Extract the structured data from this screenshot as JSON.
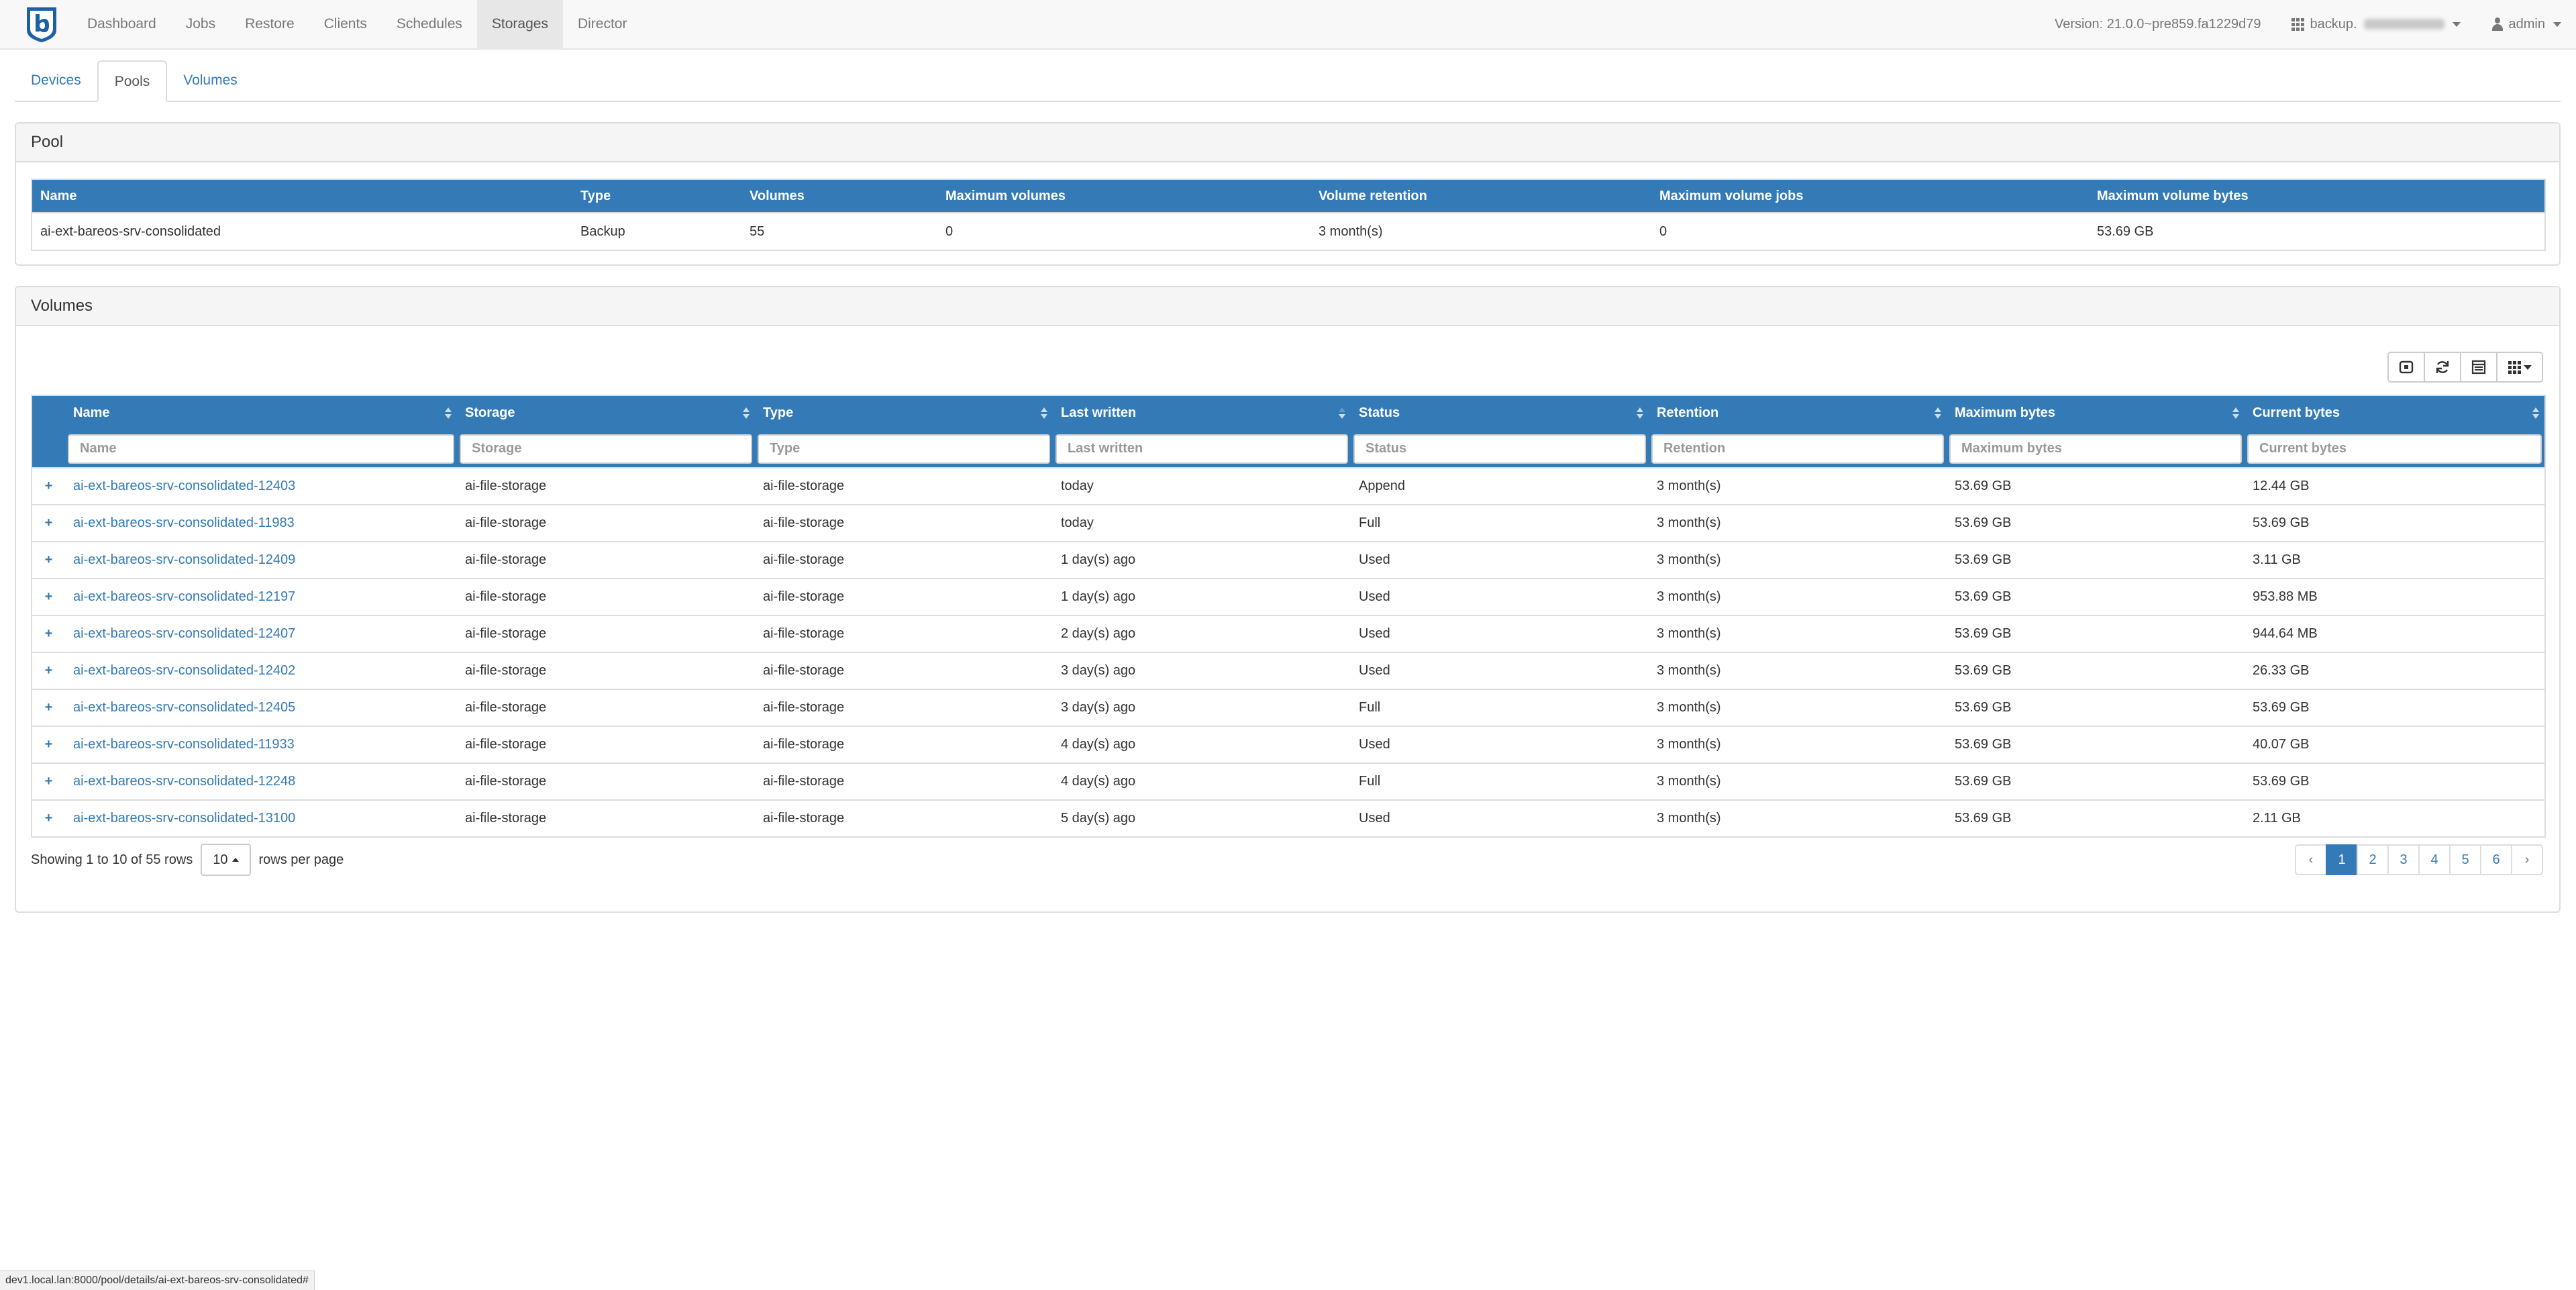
{
  "navbar": {
    "items": [
      {
        "label": "Dashboard"
      },
      {
        "label": "Jobs"
      },
      {
        "label": "Restore"
      },
      {
        "label": "Clients"
      },
      {
        "label": "Schedules"
      },
      {
        "label": "Storages"
      },
      {
        "label": "Director"
      }
    ],
    "active_index": 5,
    "version": "Version: 21.0.0~pre859.fa1229d79",
    "director_label": "backup.",
    "user_label": "admin"
  },
  "subtabs": [
    {
      "label": "Devices"
    },
    {
      "label": "Pools"
    },
    {
      "label": "Volumes"
    }
  ],
  "pool_panel": {
    "title": "Pool",
    "columns": [
      "Name",
      "Type",
      "Volumes",
      "Maximum volumes",
      "Volume retention",
      "Maximum volume jobs",
      "Maximum volume bytes"
    ],
    "row": [
      "ai-ext-bareos-srv-consolidated",
      "Backup",
      "55",
      "0",
      "3 month(s)",
      "0",
      "53.69 GB"
    ]
  },
  "volumes_panel": {
    "title": "Volumes",
    "columns": [
      "Name",
      "Storage",
      "Type",
      "Last written",
      "Status",
      "Retention",
      "Maximum bytes",
      "Current bytes"
    ],
    "filter_placeholders": [
      "Name",
      "Storage",
      "Type",
      "Last written",
      "Status",
      "Retention",
      "Maximum bytes",
      "Current bytes"
    ],
    "rows": [
      [
        "ai-ext-bareos-srv-consolidated-12403",
        "ai-file-storage",
        "ai-file-storage",
        "today",
        "Append",
        "3 month(s)",
        "53.69 GB",
        "12.44 GB"
      ],
      [
        "ai-ext-bareos-srv-consolidated-11983",
        "ai-file-storage",
        "ai-file-storage",
        "today",
        "Full",
        "3 month(s)",
        "53.69 GB",
        "53.69 GB"
      ],
      [
        "ai-ext-bareos-srv-consolidated-12409",
        "ai-file-storage",
        "ai-file-storage",
        "1 day(s) ago",
        "Used",
        "3 month(s)",
        "53.69 GB",
        "3.11 GB"
      ],
      [
        "ai-ext-bareos-srv-consolidated-12197",
        "ai-file-storage",
        "ai-file-storage",
        "1 day(s) ago",
        "Used",
        "3 month(s)",
        "53.69 GB",
        "953.88 MB"
      ],
      [
        "ai-ext-bareos-srv-consolidated-12407",
        "ai-file-storage",
        "ai-file-storage",
        "2 day(s) ago",
        "Used",
        "3 month(s)",
        "53.69 GB",
        "944.64 MB"
      ],
      [
        "ai-ext-bareos-srv-consolidated-12402",
        "ai-file-storage",
        "ai-file-storage",
        "3 day(s) ago",
        "Used",
        "3 month(s)",
        "53.69 GB",
        "26.33 GB"
      ],
      [
        "ai-ext-bareos-srv-consolidated-12405",
        "ai-file-storage",
        "ai-file-storage",
        "3 day(s) ago",
        "Full",
        "3 month(s)",
        "53.69 GB",
        "53.69 GB"
      ],
      [
        "ai-ext-bareos-srv-consolidated-11933",
        "ai-file-storage",
        "ai-file-storage",
        "4 day(s) ago",
        "Used",
        "3 month(s)",
        "53.69 GB",
        "40.07 GB"
      ],
      [
        "ai-ext-bareos-srv-consolidated-12248",
        "ai-file-storage",
        "ai-file-storage",
        "4 day(s) ago",
        "Full",
        "3 month(s)",
        "53.69 GB",
        "53.69 GB"
      ],
      [
        "ai-ext-bareos-srv-consolidated-13100",
        "ai-file-storage",
        "ai-file-storage",
        "5 day(s) ago",
        "Used",
        "3 month(s)",
        "53.69 GB",
        "2.11 GB"
      ]
    ],
    "showing_text": "Showing 1 to 10 of 55 rows",
    "page_size": "10",
    "rows_per_page_text": "rows per page",
    "pages": [
      "‹",
      "1",
      "2",
      "3",
      "4",
      "5",
      "6",
      "›"
    ],
    "active_page": "1"
  },
  "status_url": "dev1.local.lan:8000/pool/details/ai-ext-bareos-srv-consolidated#",
  "colors": {
    "header_blue": "#337ab7",
    "link_blue": "#337ab7",
    "navbar_bg": "#f8f8f8"
  },
  "icons": {
    "brand": "bareos-logo-icon",
    "toolbar": [
      "toggle-icon",
      "refresh-icon",
      "columns-list-icon",
      "grid-icon"
    ],
    "expand": "plus-icon"
  }
}
